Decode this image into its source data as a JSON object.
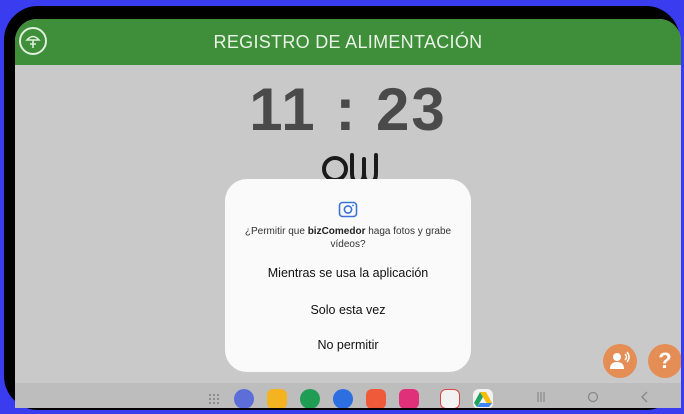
{
  "header": {
    "title": "REGISTRO DE ALIMENTACIÓN"
  },
  "clock": {
    "time": "11 : 23"
  },
  "dialog": {
    "message_prefix": "¿Permitir que ",
    "app_name": "bizComedor",
    "message_suffix": " haga fotos y grabe vídeos?",
    "options": [
      "Mientras se usa la aplicación",
      "Solo esta vez",
      "No permitir"
    ]
  },
  "fabs": {
    "help_label": "?"
  },
  "taskbar": {
    "apps": [
      "apps-grid-icon",
      "messages-icon",
      "files-icon",
      "phone-icon",
      "chat-icon",
      "contacts-icon",
      "camera-icon",
      "gmail-icon",
      "drive-icon"
    ],
    "nav": [
      "recent-apps-icon",
      "home-icon",
      "back-icon"
    ]
  },
  "colors": {
    "header": "#3f8e3a",
    "fab": "#e48e56",
    "frame": "#3a3cf0",
    "dialog_icon": "#3b74d6"
  }
}
